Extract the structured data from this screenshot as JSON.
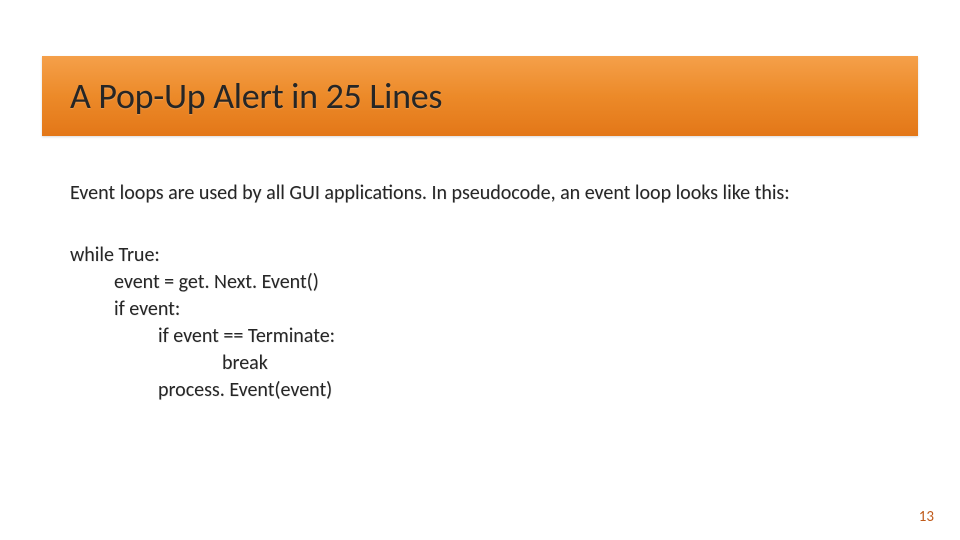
{
  "title": "A Pop-Up Alert in 25 Lines",
  "intro": "Event loops are used by all GUI applications. In pseudocode, an event loop looks like this:",
  "code": {
    "l1": "while True:",
    "l2": "event = get. Next. Event()",
    "l3": "if event:",
    "l4": "if event == Terminate:",
    "l5": "break",
    "l6": "process. Event(event)"
  },
  "page_number": "13"
}
